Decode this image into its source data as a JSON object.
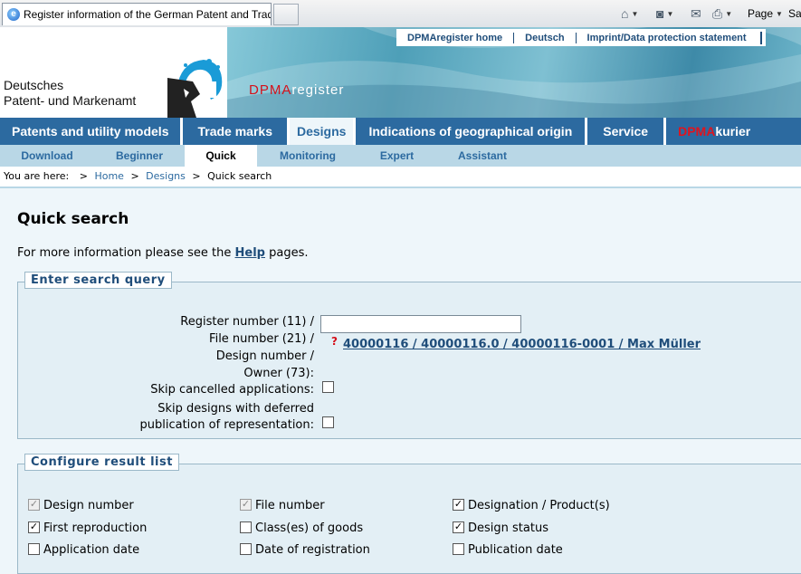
{
  "browser": {
    "tab_title": "Register information of the German Patent and Trade ...",
    "commands": [
      "Page",
      "Sa"
    ]
  },
  "header": {
    "brand_line1": "Deutsches",
    "brand_line2": "Patent- und Markenamt",
    "register_title_red": "DPMA",
    "register_title_white": "register",
    "top_links": [
      "DPMAregister home",
      "Deutsch",
      "Imprint/Data protection statement"
    ]
  },
  "mainnav": {
    "items": [
      {
        "label": "Patents and utility models"
      },
      {
        "label": "Trade marks"
      },
      {
        "label": "Designs"
      },
      {
        "label": "Indications of geographical origin"
      },
      {
        "label": "Service"
      }
    ],
    "kurier_red": "DPMA",
    "kurier_white": "kurier"
  },
  "subnav": {
    "items": [
      "Download",
      "Beginner",
      "Quick",
      "Monitoring",
      "Expert",
      "Assistant"
    ]
  },
  "breadcrumb": {
    "prefix": "You are here:",
    "sep": ">",
    "home": "Home",
    "designs": "Designs",
    "current": "Quick search"
  },
  "page": {
    "title": "Quick search",
    "info_before": "For more information please see the",
    "info_link": "Help",
    "info_after": "pages."
  },
  "search": {
    "legend": "Enter search query",
    "label_register": "Register number (11) /",
    "label_file": "File number (21) /",
    "label_design": "Design number /",
    "label_owner": "Owner (73):",
    "input_value": "",
    "help_mark": "?",
    "example": "40000116 / 40000116.0 / 40000116-0001 / Max Müller",
    "skip_cancelled": "Skip cancelled applications:",
    "skip_deferred_1": "Skip designs with deferred",
    "skip_deferred_2": "publication of representation:"
  },
  "result": {
    "legend": "Configure result list",
    "options": [
      {
        "label": "Design number",
        "checked": true,
        "disabled": true
      },
      {
        "label": "File number",
        "checked": true,
        "disabled": true
      },
      {
        "label": "Designation / Product(s)",
        "checked": true,
        "disabled": false
      },
      {
        "label": "First reproduction",
        "checked": true,
        "disabled": false
      },
      {
        "label": "Class(es) of goods",
        "checked": false,
        "disabled": false
      },
      {
        "label": "Design status",
        "checked": true,
        "disabled": false
      },
      {
        "label": "Application date",
        "checked": false,
        "disabled": false
      },
      {
        "label": "Date of registration",
        "checked": false,
        "disabled": false
      },
      {
        "label": "Publication date",
        "checked": false,
        "disabled": false
      }
    ]
  }
}
